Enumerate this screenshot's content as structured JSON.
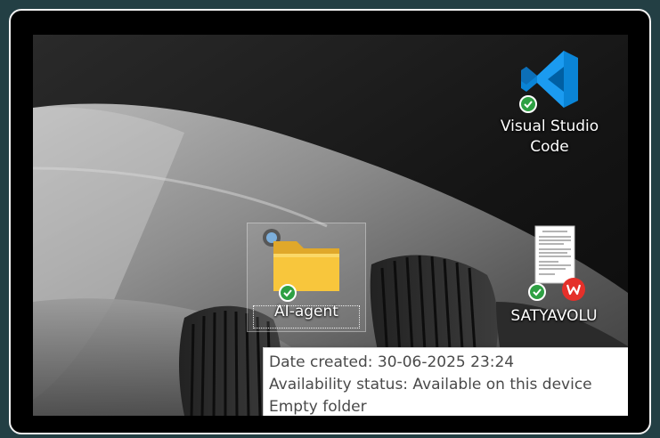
{
  "desktop": {
    "icons": [
      {
        "label": "Visual Studio Code",
        "label_lines": [
          "Visual Studio",
          "Code"
        ],
        "icon": "vscode-icon",
        "status": "synced-check-icon",
        "selected": false
      },
      {
        "label": "AI-agent",
        "icon": "folder-icon",
        "status": "synced-check-icon",
        "selected": true
      },
      {
        "label": "SATYAVOLU",
        "icon": "document-thumbnail-icon",
        "status": "synced-check-icon",
        "app_badge": "wps-office-icon",
        "selected": false
      }
    ]
  },
  "tooltip": {
    "lines": [
      "Date created: 30-06-2025 23:24",
      "Availability status: Available on this device",
      "Empty folder"
    ]
  },
  "colors": {
    "outer_background": "#233f44",
    "sync_badge": "#2ea043",
    "vscode_blue": "#0a84d6",
    "folder_yellow": "#f8c63c",
    "wps_red": "#e5302a",
    "tooltip_text": "#4a4a4a"
  }
}
